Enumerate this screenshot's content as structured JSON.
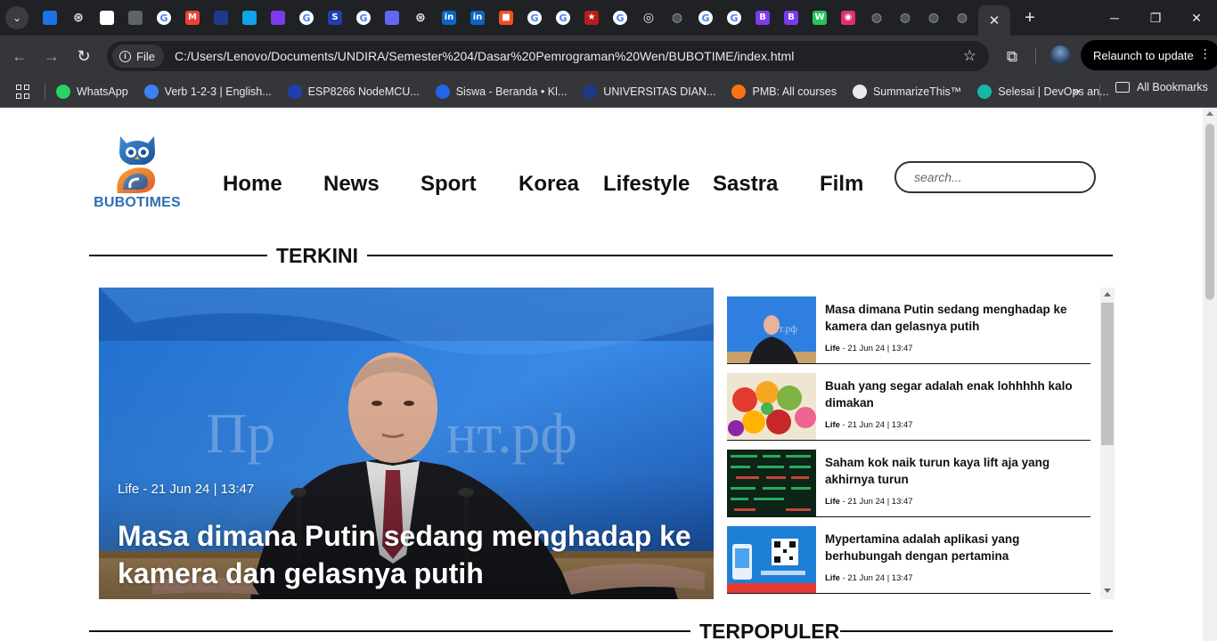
{
  "browser": {
    "tabs": [
      {
        "icon": "favicon-blue-square",
        "color": "#1a73e8"
      },
      {
        "icon": "chatgpt-icon",
        "color": "#e8eaed"
      },
      {
        "icon": "favicon-doc",
        "color": "#ffffff"
      },
      {
        "icon": "favicon-circle-o",
        "color": "#5f6368"
      },
      {
        "icon": "google-icon",
        "color": "#4285f4"
      },
      {
        "icon": "gmail-icon",
        "color": "#ea4335"
      },
      {
        "icon": "favicon-dark-bar",
        "color": "#1e3a8a"
      },
      {
        "icon": "favicon-hex",
        "color": "#0ea5e9"
      },
      {
        "icon": "favicon-list-purple",
        "color": "#7c3aed"
      },
      {
        "icon": "google-icon",
        "color": "#4285f4"
      },
      {
        "icon": "favicon-s-blue",
        "color": "#1e40af"
      },
      {
        "icon": "google-icon",
        "color": "#4285f4"
      },
      {
        "icon": "favicon-chat-purple",
        "color": "#6366f1"
      },
      {
        "icon": "chatgpt-icon",
        "color": "#e8eaed"
      },
      {
        "icon": "linkedin-icon",
        "color": "#0a66c2"
      },
      {
        "icon": "linkedin-icon",
        "color": "#0a66c2"
      },
      {
        "icon": "microsoft-icon",
        "color": "#f25022"
      },
      {
        "icon": "google-icon",
        "color": "#4285f4"
      },
      {
        "icon": "google-icon",
        "color": "#4285f4"
      },
      {
        "icon": "favicon-star-dark",
        "color": "#b91c1c"
      },
      {
        "icon": "google-icon",
        "color": "#4285f4"
      },
      {
        "icon": "chrome-icon",
        "color": "#e8eaed"
      },
      {
        "icon": "globe-icon",
        "color": "#9aa0a6"
      },
      {
        "icon": "google-icon",
        "color": "#4285f4"
      },
      {
        "icon": "google-icon",
        "color": "#4285f4"
      },
      {
        "icon": "favicon-b-purple",
        "color": "#7c3aed"
      },
      {
        "icon": "favicon-b-purple",
        "color": "#7c3aed"
      },
      {
        "icon": "favicon-w-green",
        "color": "#22c55e"
      },
      {
        "icon": "instagram-icon",
        "color": "#e1306c"
      },
      {
        "icon": "globe-icon",
        "color": "#9aa0a6"
      },
      {
        "icon": "globe-icon",
        "color": "#9aa0a6"
      },
      {
        "icon": "globe-icon",
        "color": "#9aa0a6"
      },
      {
        "icon": "globe-icon",
        "color": "#9aa0a6"
      }
    ],
    "address": {
      "scheme_label": "File",
      "url": "C:/Users/Lenovo/Documents/UNDIRA/Semester%204/Dasar%20Pemrograman%20Wen/BUBOTIME/index.html"
    },
    "relaunch_label": "Relaunch to update",
    "bookmarks": [
      {
        "label": "WhatsApp",
        "icon": "whatsapp-icon",
        "color": "#25d366"
      },
      {
        "label": "Verb 1-2-3 | English...",
        "icon": "favicon-verb",
        "color": "#3b82f6"
      },
      {
        "label": "ESP8266 NodeMCU...",
        "icon": "favicon-r",
        "color": "#1e40af"
      },
      {
        "label": "Siswa - Beranda • Kl...",
        "icon": "favicon-siswa",
        "color": "#2563eb"
      },
      {
        "label": "UNIVERSITAS DIAN...",
        "icon": "favicon-univ",
        "color": "#1e3a8a"
      },
      {
        "label": "PMB: All courses",
        "icon": "favicon-moodle",
        "color": "#f97316"
      },
      {
        "label": "SummarizeThis™",
        "icon": "globe-icon",
        "color": "#e8eaed"
      },
      {
        "label": "Selesai | DevOps an...",
        "icon": "favicon-infinity",
        "color": "#14b8a6"
      }
    ],
    "all_bookmarks_label": "All Bookmarks"
  },
  "site": {
    "logo_text": "BUBOTIMES",
    "nav": [
      "Home",
      "News",
      "Sport",
      "Korea",
      "Lifestyle",
      "Sastra",
      "Film"
    ],
    "search_placeholder": "search...",
    "section_terkini": "TERKINI",
    "section_terpopuler": "TERPOPULER",
    "hero": {
      "meta": "Life - 21 Jun 24 | 13:47",
      "title": "Masa dimana Putin sedang menghadap ke kamera dan gelasnya putih"
    },
    "list": [
      {
        "title": "Masa dimana Putin sedang menghadap ke kamera dan gelasnya putih",
        "category": "Life",
        "date": " - 21 Jun 24 | 13:47"
      },
      {
        "title": "Buah yang segar adalah enak lohhhhh kalo dimakan",
        "category": "Life",
        "date": " - 21 Jun 24 | 13:47"
      },
      {
        "title": "Saham kok naik turun kaya lift aja yang akhirnya turun",
        "category": "Life",
        "date": " - 21 Jun 24 | 13:47"
      },
      {
        "title": "Mypertamina adalah aplikasi yang berhubungah dengan pertamina",
        "category": "Life",
        "date": " - 21 Jun 24 | 13:47"
      }
    ]
  },
  "colors": {
    "chrome_dark": "#202124",
    "chrome_toolbar": "#35363a",
    "logo_blue": "#2f6fb3",
    "logo_orange": "#f28c28"
  }
}
